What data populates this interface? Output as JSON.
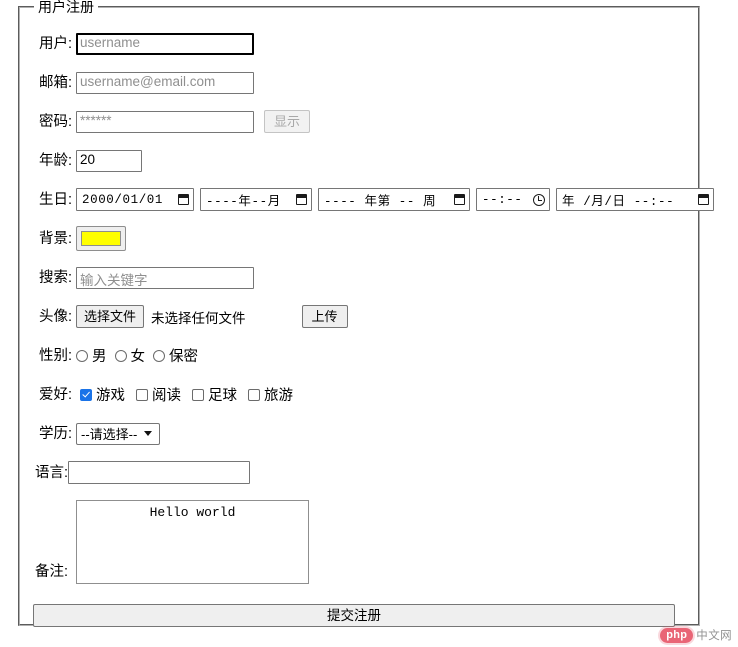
{
  "form": {
    "legend": "用户注册",
    "labels": {
      "username": "用户:",
      "email": "邮箱:",
      "password": "密码:",
      "age": "年龄:",
      "birthday": "生日:",
      "background": "背景:",
      "search": "搜索:",
      "avatar": "头像:",
      "gender": "性别:",
      "hobby": "爱好:",
      "education": "学历:",
      "language": "语言:",
      "remark": "备注:"
    },
    "username_input": {
      "value": "",
      "placeholder": "username"
    },
    "email_input": {
      "value": "",
      "placeholder": "username@email.com"
    },
    "password_input": {
      "value": "",
      "placeholder": "******"
    },
    "password_toggle_button": "显示",
    "age_input": {
      "value": "20",
      "placeholder": ""
    },
    "date_fields": [
      {
        "name": "date",
        "value": "2000/01/01",
        "icon": "calendar-icon"
      },
      {
        "name": "month",
        "value": "----年--月",
        "icon": "calendar-icon"
      },
      {
        "name": "week",
        "value": "---- 年第 -- 周",
        "icon": "calendar-icon"
      },
      {
        "name": "time",
        "value": "--:--",
        "icon": "clock-icon"
      },
      {
        "name": "datetime-local",
        "value": "年 /月/日 --:--",
        "icon": "calendar-icon"
      }
    ],
    "background_color": "#ffff00",
    "search_input": {
      "value": "",
      "placeholder": "输入关键字"
    },
    "file_button": "选择文件",
    "file_status": "未选择任何文件",
    "upload_button": "上传",
    "gender_options": [
      {
        "label": "男",
        "checked": false
      },
      {
        "label": "女",
        "checked": false
      },
      {
        "label": "保密",
        "checked": false
      }
    ],
    "hobby_options": [
      {
        "label": "游戏",
        "checked": true
      },
      {
        "label": "阅读",
        "checked": false
      },
      {
        "label": "足球",
        "checked": false
      },
      {
        "label": "旅游",
        "checked": false
      }
    ],
    "education_select": {
      "selected": "--请选择--"
    },
    "language_input": {
      "value": "",
      "placeholder": ""
    },
    "remark_textarea": {
      "value": "Hello world"
    },
    "submit_button": "提交注册"
  },
  "watermark": {
    "badge": "php",
    "text": "中文网"
  }
}
